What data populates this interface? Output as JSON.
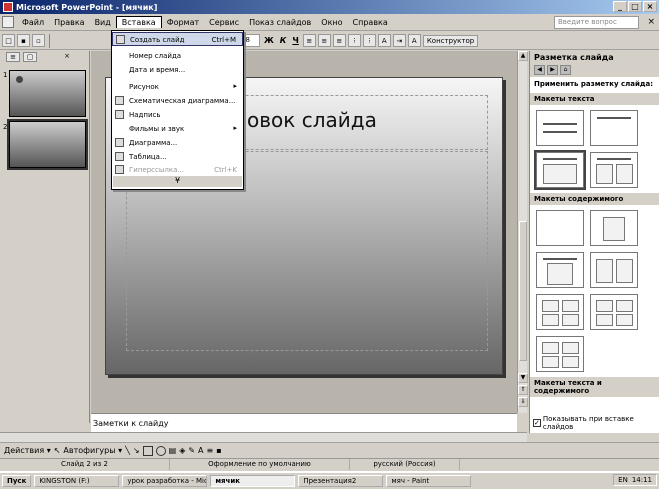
{
  "window": {
    "title": "Microsoft PowerPoint - [мячик]",
    "buttons": [
      "_",
      "□",
      "×"
    ]
  },
  "menu": {
    "items": [
      "Файл",
      "Правка",
      "Вид",
      "Вставка",
      "Формат",
      "Сервис",
      "Показ слайдов",
      "Окно",
      "Справка"
    ],
    "active_index": 3,
    "question_placeholder": "Введите вопрос"
  },
  "toolbar": {
    "font": "Arial",
    "size": "18",
    "bold": "Ж",
    "italic": "К",
    "underline": "Ч",
    "constructor": "Конструктор"
  },
  "dropdown": {
    "items": [
      {
        "label": "Создать слайд",
        "shortcut": "Ctrl+M",
        "highlight": true
      },
      {
        "label": "Номер слайда"
      },
      {
        "label": "Дата и время..."
      },
      {
        "label": "Рисунок",
        "submenu": true
      },
      {
        "label": "Схематическая диаграмма..."
      },
      {
        "label": "Надпись"
      },
      {
        "label": "Фильмы и звук",
        "submenu": true
      },
      {
        "label": "Диаграмма..."
      },
      {
        "label": "Таблица..."
      },
      {
        "label": "Гиперссылка...",
        "shortcut": "Ctrl+K",
        "disabled": true
      }
    ],
    "expand": "¥"
  },
  "slides_panel": {
    "numbers": [
      "1",
      "2"
    ]
  },
  "slide": {
    "title": "оловок слайда",
    "text": "а"
  },
  "notes": {
    "placeholder": "Заметки к слайду"
  },
  "taskpane": {
    "title": "Разметка слайда",
    "apply": "Применить разметку слайда:",
    "sec_text": "Макеты текста",
    "sec_content": "Макеты содержимого",
    "sec_text_content": "Макеты текста и содержимого",
    "show_checkbox": "Показывать при вставке слайдов"
  },
  "drawbar": {
    "actions": "Действия ▾",
    "autoshapes": "Автофигуры ▾"
  },
  "statusbar": {
    "slide": "Слайд 2 из 2",
    "design": "Оформление по умолчанию",
    "language": "русский (Россия)"
  },
  "taskbar": {
    "start": "Пуск",
    "tasks": [
      "KINGSTON (F:)",
      "урок разработка - Mic...",
      "мячик",
      "Презентация2",
      "мяч - Paint"
    ],
    "active_task": 2,
    "tray_lang": "EN",
    "clock": "14:11"
  }
}
